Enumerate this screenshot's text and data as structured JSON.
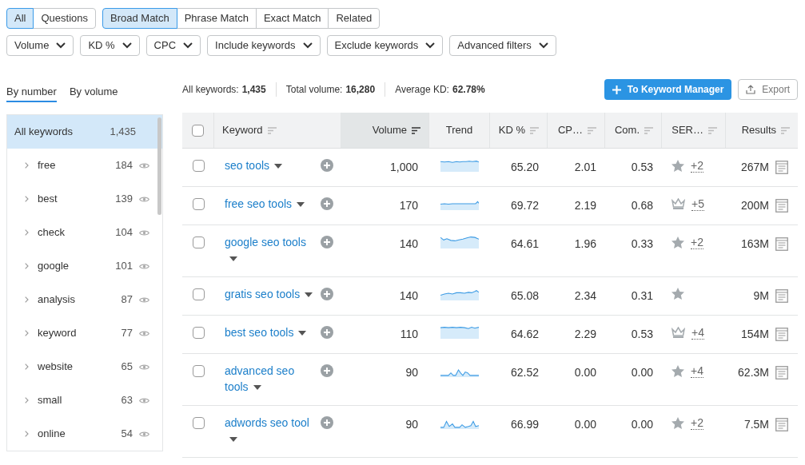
{
  "type_tabs": [
    {
      "label": "All",
      "selected": true
    },
    {
      "label": "Questions",
      "selected": false
    }
  ],
  "match_tabs": [
    {
      "label": "Broad Match",
      "selected": true
    },
    {
      "label": "Phrase Match",
      "selected": false
    },
    {
      "label": "Exact Match",
      "selected": false
    },
    {
      "label": "Related",
      "selected": false
    }
  ],
  "filters": [
    "Volume",
    "KD %",
    "CPC",
    "Include keywords",
    "Exclude keywords",
    "Advanced filters"
  ],
  "group_tabs": [
    {
      "label": "By number",
      "selected": true
    },
    {
      "label": "By volume",
      "selected": false
    }
  ],
  "stats": [
    {
      "label": "All keywords:",
      "value": "1,435"
    },
    {
      "label": "Total volume:",
      "value": "16,280"
    },
    {
      "label": "Average KD:",
      "value": "62.78%"
    }
  ],
  "buttons": {
    "primary": "To Keyword Manager",
    "export": "Export"
  },
  "groups": [
    {
      "kind": "all",
      "label": "All keywords",
      "count": "1,435",
      "selected": true
    },
    {
      "kind": "group",
      "label": "free",
      "count": "184",
      "selected": false
    },
    {
      "kind": "group",
      "label": "best",
      "count": "139",
      "selected": false
    },
    {
      "kind": "group",
      "label": "check",
      "count": "104",
      "selected": false
    },
    {
      "kind": "group",
      "label": "google",
      "count": "101",
      "selected": false
    },
    {
      "kind": "group",
      "label": "analysis",
      "count": "87",
      "selected": false
    },
    {
      "kind": "group",
      "label": "keyword",
      "count": "77",
      "selected": false
    },
    {
      "kind": "group",
      "label": "website",
      "count": "65",
      "selected": false
    },
    {
      "kind": "group",
      "label": "small",
      "count": "63",
      "selected": false
    },
    {
      "kind": "group",
      "label": "online",
      "count": "54",
      "selected": false
    }
  ],
  "table": {
    "all_checked": false,
    "columns": [
      {
        "label": "Keyword",
        "sorted": false
      },
      {
        "label": "Volume",
        "sorted": true
      },
      {
        "label": "Trend",
        "sorted": false
      },
      {
        "label": "KD %",
        "sorted": false
      },
      {
        "label": "CP…",
        "sorted": false
      },
      {
        "label": "Com.",
        "sorted": false
      },
      {
        "label": "SER…",
        "sorted": false
      },
      {
        "label": "Results",
        "sorted": false
      }
    ],
    "rows": [
      {
        "checked": false,
        "keyword": "seo tools",
        "volume": "1,000",
        "kd": "65.20",
        "cpc": "2.01",
        "com": "0.53",
        "kind": "star",
        "extra": "+2",
        "results": "267M"
      },
      {
        "checked": false,
        "keyword": "free seo tools",
        "volume": "170",
        "kd": "69.72",
        "cpc": "2.19",
        "com": "0.68",
        "kind": "crown",
        "extra": "+5",
        "results": "200M"
      },
      {
        "checked": false,
        "keyword": "google seo tools",
        "volume": "140",
        "kd": "64.61",
        "cpc": "1.96",
        "com": "0.33",
        "kind": "star",
        "extra": "+2",
        "results": "163M"
      },
      {
        "checked": false,
        "keyword": "gratis seo tools",
        "volume": "140",
        "kd": "65.08",
        "cpc": "2.34",
        "com": "0.31",
        "kind": "star",
        "results": "9M"
      },
      {
        "checked": false,
        "keyword": "best seo tools",
        "volume": "110",
        "kd": "64.62",
        "cpc": "2.29",
        "com": "0.53",
        "kind": "crown",
        "extra": "+4",
        "results": "154M"
      },
      {
        "checked": false,
        "keyword": "advanced seo tools",
        "volume": "90",
        "kd": "62.52",
        "cpc": "0.00",
        "com": "0.00",
        "kind": "star",
        "extra": "+4",
        "results": "62.3M"
      },
      {
        "checked": false,
        "keyword": "adwords seo tool",
        "volume": "90",
        "kd": "66.99",
        "cpc": "0.00",
        "com": "0.00",
        "kind": "star",
        "extra": "+2",
        "results": "7.5M"
      }
    ]
  }
}
